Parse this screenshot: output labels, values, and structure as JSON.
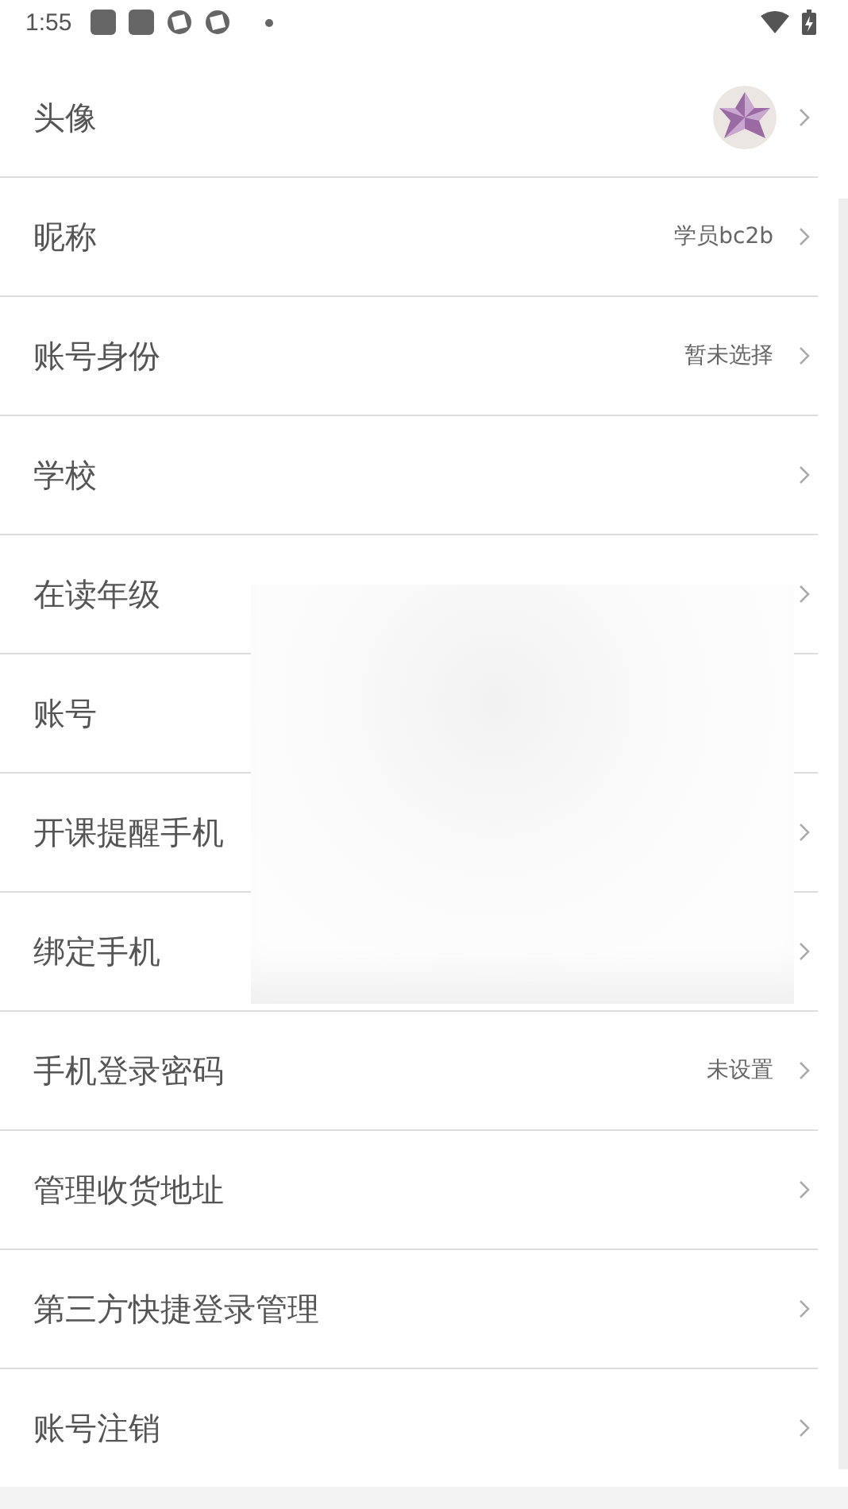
{
  "status_bar": {
    "time": "1:55"
  },
  "rows": [
    {
      "label": "头像",
      "kind": "avatar",
      "chevron": true
    },
    {
      "label": "昵称",
      "value": "学员bc2b",
      "chevron": true
    },
    {
      "label": "账号身份",
      "value": "暂未选择",
      "chevron": true
    },
    {
      "label": "学校",
      "chevron": true
    },
    {
      "label": "在读年级",
      "chevron": true
    },
    {
      "label": "账号",
      "chevron": false
    },
    {
      "label": "开课提醒手机",
      "chevron": true
    },
    {
      "label": "绑定手机",
      "chevron": true
    },
    {
      "label": "手机登录密码",
      "value": "未设置",
      "chevron": true
    },
    {
      "label": "管理收货地址",
      "chevron": true
    },
    {
      "label": "第三方快捷登录管理",
      "chevron": true
    },
    {
      "label": "账号注销",
      "chevron": true
    }
  ]
}
